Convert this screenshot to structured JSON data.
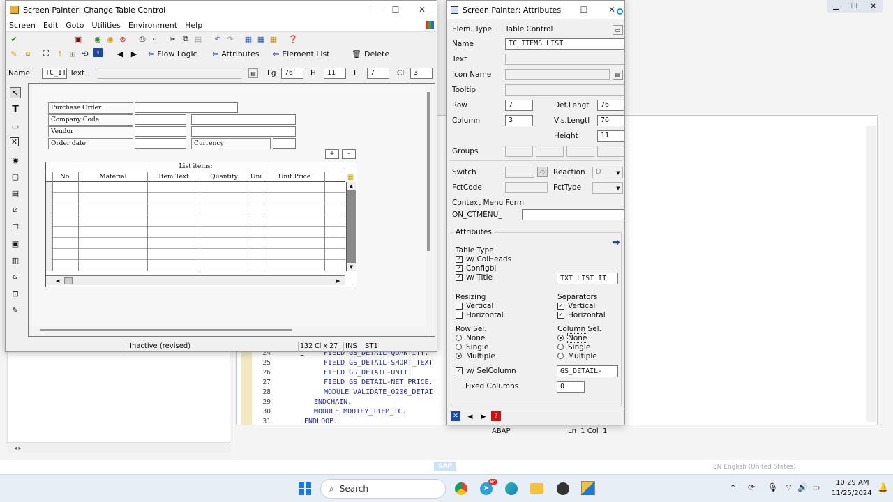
{
  "painter": {
    "title": "Screen Painter: Change Table Control",
    "menu": [
      "Screen",
      "Edit",
      "Goto",
      "Utilities",
      "Environment",
      "Help"
    ],
    "app_toolbar": {
      "flow_logic": "Flow Logic",
      "attributes": "Attributes",
      "element_list": "Element List",
      "delete": "Delete"
    },
    "name_bar": {
      "name_label": "Name",
      "name_value": "TC_ITEMS_LIST",
      "text_label": "Text",
      "lg_label": "Lg",
      "lg_value": "76",
      "h_label": "H",
      "h_value": "11",
      "l_label": "L",
      "l_value": "7",
      "cl_label": "Cl",
      "cl_value": "3"
    },
    "form": {
      "purchase_order": "Purchase Order",
      "company_code": "Company Code",
      "vendor": "Vendor",
      "order_date": "Order date:",
      "currency": "Currency"
    },
    "table": {
      "title": "List items:",
      "columns": [
        "No.",
        "Material",
        "Item Text",
        "Quantity",
        "Uni",
        "Unit Price"
      ],
      "plus": "+",
      "minus": "-"
    },
    "status": {
      "state": "Inactive (revised)",
      "size": "132 Cl x 27 L",
      "mode": "INS",
      "st": "ST1"
    }
  },
  "attrs": {
    "title": "Screen Painter: Attributes",
    "elem_type_label": "Elem. Type",
    "elem_type_value": "Table Control",
    "name_label": "Name",
    "name_value": "TC_ITEMS_LIST",
    "text_label": "Text",
    "icon_label": "Icon Name",
    "tooltip_label": "Tooltip",
    "row_label": "Row",
    "row_value": "7",
    "deflen_label": "Def.Lengt",
    "deflen_value": "76",
    "col_label": "Column",
    "col_value": "3",
    "vislen_label": "Vis.Lengtl",
    "vislen_value": "76",
    "height_label": "Height",
    "height_value": "11",
    "groups_label": "Groups",
    "switch_label": "Switch",
    "reaction_label": "Reaction",
    "reaction_value": "D",
    "fctcode_label": "FctCode",
    "fcttype_label": "FctType",
    "ctx_label": "Context Menu Form",
    "ctx_prefix": "ON_CTMENU_",
    "attributes_header": "Attributes",
    "table_type": "Table Type",
    "colheads": "w/ ColHeads",
    "configbl": "Configbl",
    "wtitle": "w/ Title",
    "title_field": "TXT_LIST_IT",
    "resizing": "Resizing",
    "vertical": "Vertical",
    "horizontal": "Horizontal",
    "separators": "Separators",
    "rowsel": "Row Sel.",
    "colsel": "Column Sel.",
    "none": "None",
    "single": "Single",
    "multiple": "Multiple",
    "selcolumn": "w/ SelColumn",
    "selcolumn_value": "GS_DETAIL-",
    "fixed_columns": "Fixed Columns",
    "fixed_value": "0"
  },
  "code": {
    "lines": [
      {
        "n": "24",
        "text": "FIELD GS_DETAIL-QUANTITY."
      },
      {
        "n": "25",
        "text": "FIELD GS_DETAIL-SHORT_TEXT"
      },
      {
        "n": "26",
        "text": "FIELD GS_DETAIL-UNIT."
      },
      {
        "n": "27",
        "text": "FIELD GS_DETAIL-NET_PRICE."
      },
      {
        "n": "28",
        "text": "MODULE VALIDATE_0200_DETAI"
      },
      {
        "n": "29",
        "text": "ENDCHAIN."
      },
      {
        "n": "30",
        "text": "MODULE MODIFY_ITEM_TC."
      },
      {
        "n": "31",
        "text": "ENDLOOP."
      }
    ],
    "status_lang": "ABAP",
    "status_pos": "Ln  1 Col  1"
  },
  "taskbar": {
    "search": "Search",
    "time": "10:29 AM",
    "date": "11/25/2024",
    "lang": "EN English (United States)",
    "badge": "84"
  },
  "colors": {
    "accent": "#0a64c8",
    "code_blue": "#1d2a9c",
    "taskbar": "#e8eef6"
  }
}
